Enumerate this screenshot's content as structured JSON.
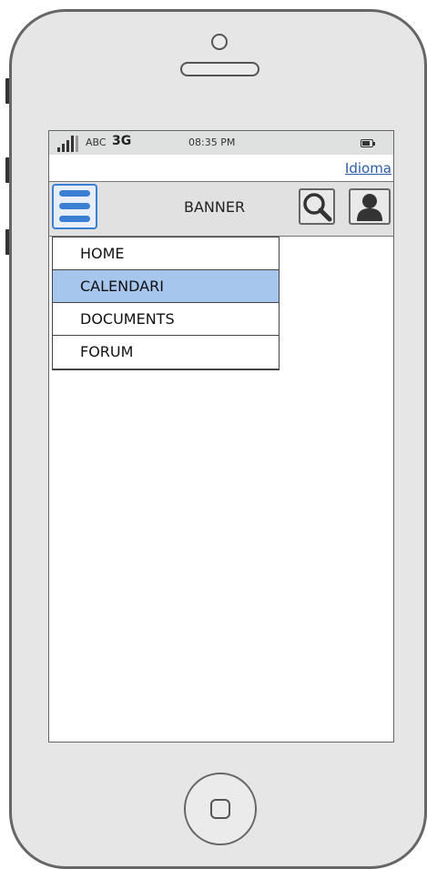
{
  "status_bar": {
    "carrier": "ABC",
    "network": "3G",
    "time": "08:35 PM",
    "signal_icon": "signal-bars-icon",
    "battery_icon": "battery-icon"
  },
  "lang_link": "Idioma",
  "header": {
    "banner": "BANNER",
    "menu_icon": "hamburger-menu-icon",
    "search_icon": "search-icon",
    "user_icon": "user-icon"
  },
  "menu": {
    "items": [
      {
        "label": "HOME",
        "selected": false
      },
      {
        "label": "CALENDARI",
        "selected": true
      },
      {
        "label": "DOCUMENTS",
        "selected": false
      },
      {
        "label": "FORUM",
        "selected": false
      }
    ]
  },
  "colors": {
    "accent": "#3b7fd4",
    "selected_item": "#a7c6ee",
    "link": "#2a5ca8"
  }
}
